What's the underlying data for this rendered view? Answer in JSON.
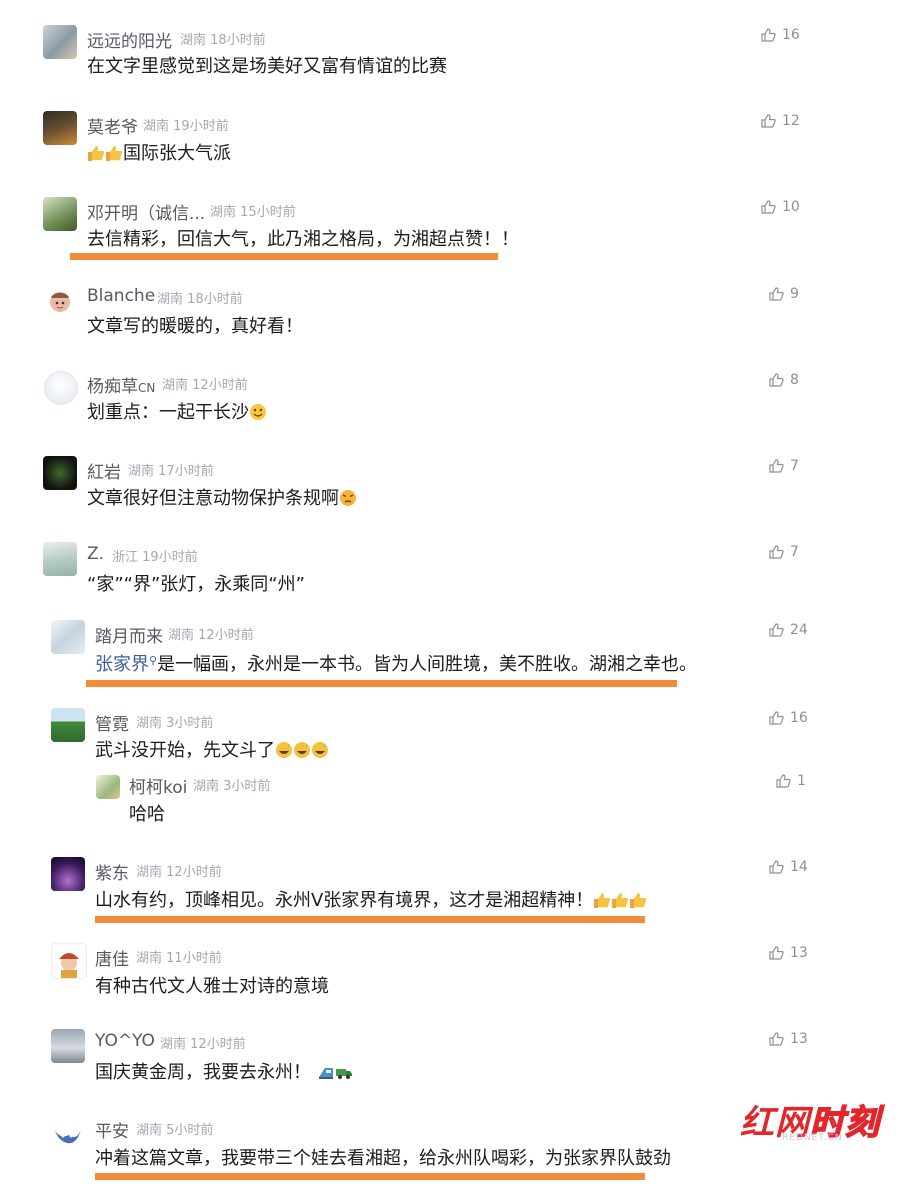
{
  "colors": {
    "highlight": "#f28c38",
    "name": "#555a63",
    "meta": "#a3a8af",
    "link": "#3b5fa0",
    "watermark_red": "#e3262b"
  },
  "comments": [
    {
      "name": "远远的阳光",
      "location": "湖南",
      "time": "18小时前",
      "text": "在文字里感觉到这是场美好又富有情谊的比赛",
      "likes": "16"
    },
    {
      "name": "莫老爷",
      "location": "湖南",
      "time": "19小时前",
      "text": "国际张大气派",
      "emoji_prefix": "thumbs-up x2",
      "likes": "12"
    },
    {
      "name": "邓开明（诚信...",
      "location": "湖南",
      "time": "15小时前",
      "text": "去信精彩，回信大气，此乃湘之格局，为湘超点赞！！",
      "likes": "10",
      "highlighted": true
    },
    {
      "name": "Blanche",
      "location": "湖南",
      "time": "18小时前",
      "text": "文章写的暖暖的，真好看！",
      "likes": "9"
    },
    {
      "name": "杨痴草",
      "name_suffix": "CN",
      "location": "湖南",
      "time": "12小时前",
      "text": "划重点：一起干长沙",
      "emoji_suffix": "smiling face",
      "likes": "8"
    },
    {
      "name": "紅岩",
      "location": "湖南",
      "time": "17小时前",
      "text": "文章很好但注意动物保护条规啊",
      "emoji_suffix": "pouting face",
      "likes": "7"
    },
    {
      "name": "Z.",
      "location": "浙江",
      "time": "19小时前",
      "text": "“家”“界”张灯，永乘同“州”",
      "likes": "7"
    },
    {
      "name": "踏月而来",
      "location": "湖南",
      "time": "12小时前",
      "link_text": "张家界",
      "text": "是一幅画，永州是一本书。皆为人间胜境，美不胜收。湖湘之幸也。",
      "likes": "24",
      "highlighted": true
    },
    {
      "name": "管霓",
      "location": "湖南",
      "time": "3小时前",
      "text": "武斗没开始，先文斗了",
      "emoji_suffix": "grinning sweat x3",
      "likes": "16"
    },
    {
      "name": "柯柯koi",
      "location": "湖南",
      "time": "3小时前",
      "text": "哈哈",
      "likes": "1",
      "reply": true
    },
    {
      "name": "紫东",
      "location": "湖南",
      "time": "12小时前",
      "text": "山水有约，顶峰相见。永州V张家界有境界，这才是湘超精神！",
      "emoji_suffix": "thumbs-up x3",
      "likes": "14",
      "highlighted": true
    },
    {
      "name": "唐佳",
      "location": "湖南",
      "time": "11小时前",
      "text": "有种古代文人雅士对诗的意境",
      "likes": "13"
    },
    {
      "name": "YO^YO",
      "location": "湖南",
      "time": "12小时前",
      "text": "国庆黄金周，我要去永州！",
      "emoji_suffix": "train, truck",
      "likes": "13"
    },
    {
      "name": "平安",
      "location": "湖南",
      "time": "5小时前",
      "text": "冲着这篇文章，我要带三个娃去看湘超，给永州队喝彩，为张家界队鼓劲",
      "likes": "",
      "highlighted": true
    }
  ],
  "watermark": {
    "red": "红网",
    "hollow": "时刻",
    "sub": "REDNET.CN"
  }
}
